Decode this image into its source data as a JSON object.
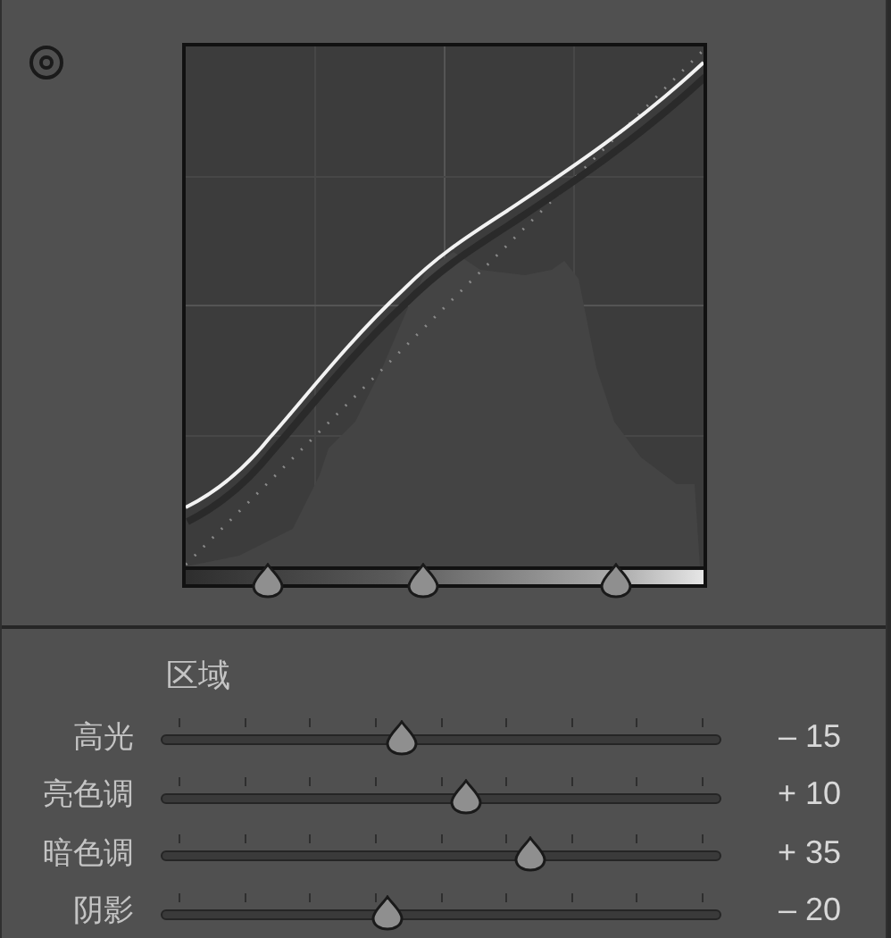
{
  "region_splits": [
    {
      "level": 0.16
    },
    {
      "level": 0.46
    },
    {
      "level": 0.83
    }
  ],
  "region_header": "区域",
  "sliders": [
    {
      "label": "高光",
      "level": 0.43,
      "reading": "– 15"
    },
    {
      "label": "亮色调",
      "level": 0.545,
      "reading": "+ 10"
    },
    {
      "label": "暗色调",
      "level": 0.66,
      "reading": "+ 35"
    },
    {
      "label": "阴影",
      "level": 0.405,
      "reading": "– 20"
    }
  ]
}
